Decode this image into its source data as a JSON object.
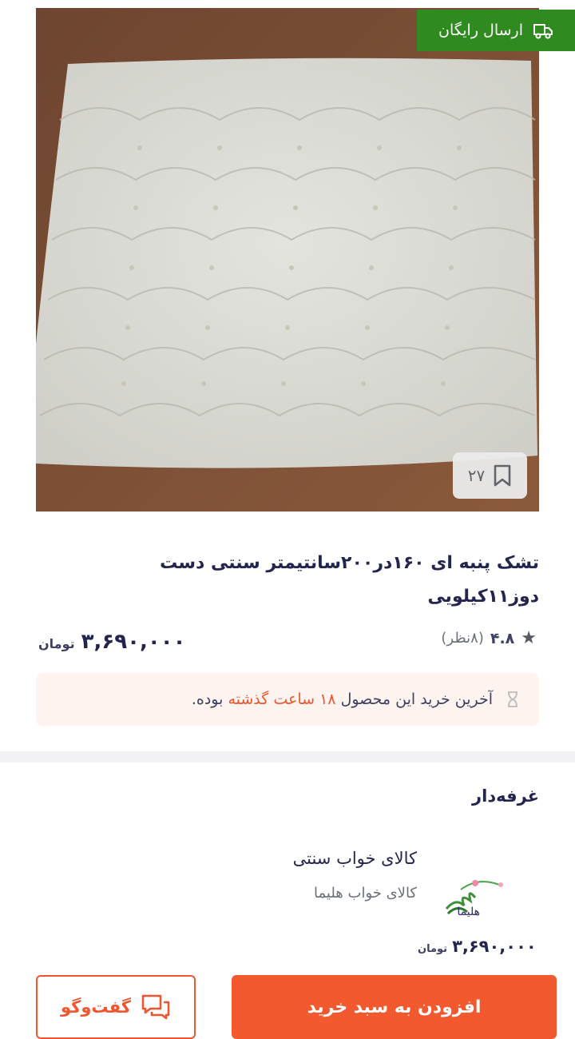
{
  "product": {
    "free_shipping_label": "ارسال رایگان",
    "bookmark_count": "۲۷",
    "title": "تشک پنبه ای ۱۶۰در۲۰۰سانتیمتر سنتی دست دوز۱۱کیلویی",
    "rating": "۴.۸",
    "reviews": "(۸نظر)",
    "price": "۳,۶۹۰,۰۰۰",
    "currency": "تومان",
    "last_purchase": {
      "prefix": "آخرین خرید این محصول",
      "highlight": "۱۸ ساعت گذشته",
      "suffix": "بوده."
    }
  },
  "seller": {
    "section_title": "غرفه‌دار",
    "name": "کالای خواب سنتی",
    "subtitle": "کالای خواب هلیما",
    "logo_text": "هلیما",
    "price": "۳,۶۹۰,۰۰۰",
    "currency": "تومان"
  },
  "actions": {
    "add_to_cart": "افزودن به سبد خرید",
    "chat": "گفت‌وگو"
  },
  "colors": {
    "accent": "#ef5630",
    "free_shipping_bg": "#2f8a20",
    "text": "#23254e"
  }
}
